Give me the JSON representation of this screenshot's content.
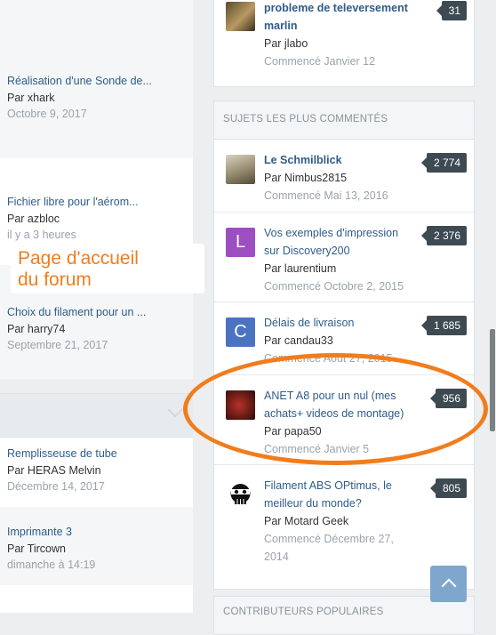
{
  "callout": {
    "line1": "Page d'accueil",
    "line2": "du forum"
  },
  "left_topics": [
    {
      "title": "Réalisation d'une Sonde de...",
      "author": "Par xhark",
      "date": "Octobre 9, 2017"
    },
    {
      "title": "Fichier libre pour l'aérom...",
      "author": "Par azbloc",
      "date": "il y a 3 heures"
    },
    {
      "title": "Choix du filament pour un ...",
      "author": "Par harry74",
      "date": "Septembre 21, 2017"
    },
    {
      "title": "Remplisseuse de tube",
      "author": "Par HERAS Melvin",
      "date": "Décembre 14, 2017"
    },
    {
      "title": "Imprimante 3",
      "author": "Par Tircown",
      "date": "dimanche à 14:19"
    }
  ],
  "top_item": {
    "title_line1": "probleme de televersement",
    "title_line2": "marlin",
    "author": "Par jlabo",
    "date": "Commencé Janvier 12",
    "count": "31"
  },
  "most_commented": {
    "header": "SUJETS LES PLUS COMMENTÉS",
    "items": [
      {
        "title": "Le Schmilblick",
        "author": "Par Nimbus2815",
        "date": "Commencé Mai 13, 2016",
        "count": "2 774"
      },
      {
        "title": "Vos exemples d'impression sur Discovery200",
        "author": "Par laurentium",
        "date": "Commencé Octobre 2, 2015",
        "count": "2 376",
        "avatar_letter": "L"
      },
      {
        "title": "Délais de livraison",
        "author": "Par candau33",
        "date": "Commencé Août 27, 2015",
        "count": "1 685",
        "avatar_letter": "C"
      },
      {
        "title": "ANET A8 pour un nul (mes achats+ videos de montage)",
        "author": "Par papa50",
        "date": "Commencé Janvier 5",
        "count": "956"
      },
      {
        "title": "Filament ABS OPtimus, le meilleur du monde?",
        "author": "Par Motard Geek",
        "date": "Commencé Décembre 27, 2014",
        "count": "805"
      }
    ]
  },
  "next_header": "CONTRIBUTEURS POPULAIRES",
  "colors": {
    "accent_orange": "#f07d1d",
    "link_blue": "#2f5c8a",
    "badge_dark": "#3d4a52",
    "avatar_L": "#9b4fc1",
    "avatar_C": "#4a73c2"
  },
  "icons": {
    "scroll_top": "chevron-up-icon",
    "collapse": "chevron-down-icon"
  }
}
